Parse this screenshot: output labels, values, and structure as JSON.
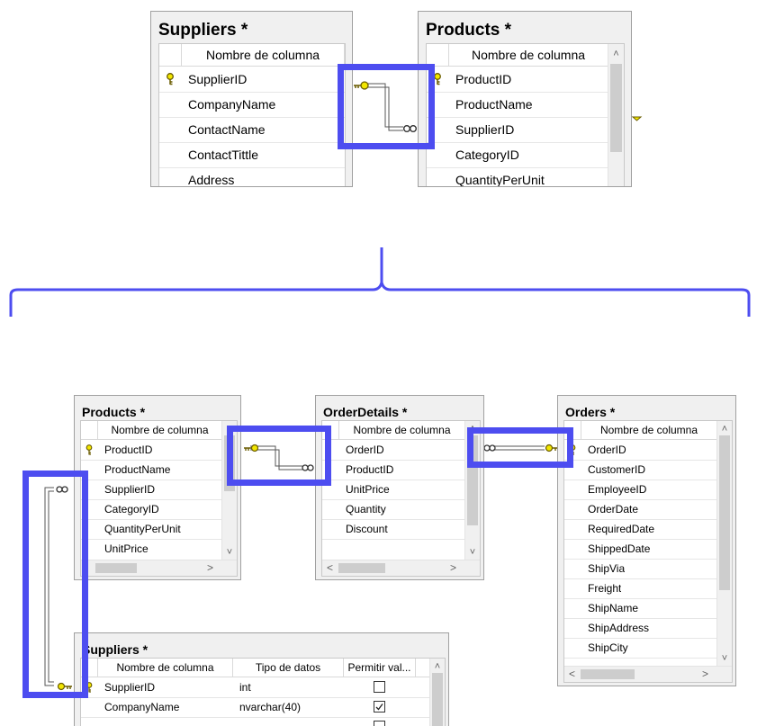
{
  "colors": {
    "highlight": "#4d4df0",
    "key": "#f2e600"
  },
  "column_header": "Nombre de columna",
  "top": {
    "suppliers": {
      "title": "Suppliers *",
      "rows": [
        "SupplierID",
        "CompanyName",
        "ContactName",
        "ContactTittle",
        "Address"
      ],
      "key_row": 0
    },
    "products": {
      "title": "Products *",
      "rows": [
        "ProductID",
        "ProductName",
        "SupplierID",
        "CategoryID",
        "QuantityPerUnit"
      ],
      "key_row": 0
    }
  },
  "bottom": {
    "products": {
      "title": "Products *",
      "rows": [
        "ProductID",
        "ProductName",
        "SupplierID",
        "CategoryID",
        "QuantityPerUnit",
        "UnitPrice"
      ],
      "key_row": 0
    },
    "orderdetails": {
      "title": "OrderDetails *",
      "rows": [
        "OrderID",
        "ProductID",
        "UnitPrice",
        "Quantity",
        "Discount"
      ]
    },
    "orders": {
      "title": "Orders *",
      "rows": [
        "OrderID",
        "CustomerID",
        "EmployeeID",
        "OrderDate",
        "RequiredDate",
        "ShippedDate",
        "ShipVia",
        "Freight",
        "ShipName",
        "ShipAddress",
        "ShipCity"
      ],
      "key_row": 0
    },
    "suppliers": {
      "title": "Suppliers *",
      "headers": [
        "Nombre de columna",
        "Tipo de datos",
        "Permitir val..."
      ],
      "rows": [
        {
          "name": "SupplierID",
          "type": "int",
          "allow_nulls": false
        },
        {
          "name": "CompanyName",
          "type": "nvarchar(40)",
          "allow_nulls": true
        }
      ]
    }
  },
  "symbols": {
    "infinity": "∞",
    "arrow_up": "˄",
    "arrow_down": "˅",
    "arrow_left": "<",
    "arrow_right": ">"
  },
  "icons": [
    "key-icon",
    "infinity-icon",
    "checkbox-icon"
  ]
}
